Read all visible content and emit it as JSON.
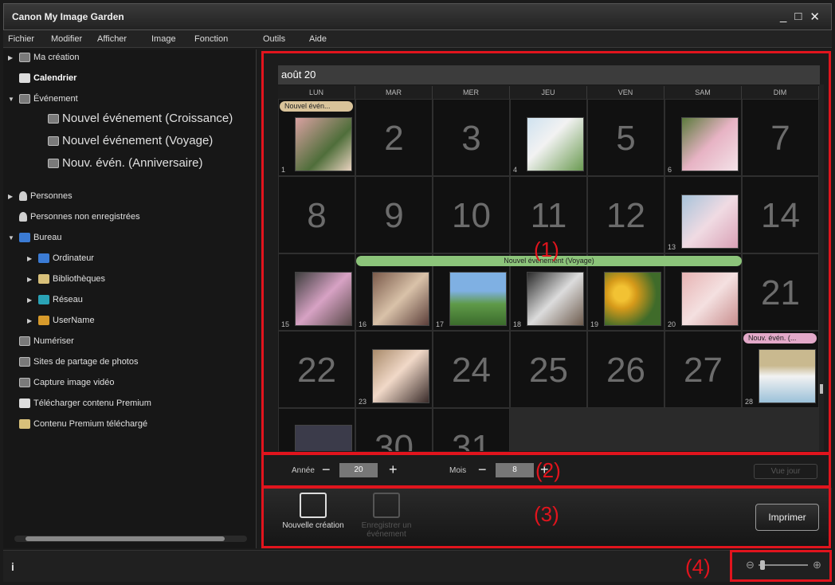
{
  "window": {
    "title": "Canon My Image Garden",
    "controls": [
      "_",
      "□",
      "✕"
    ]
  },
  "menu": [
    "Fichier",
    "Modifier",
    "Afficher",
    "Image",
    "Fonction",
    "Outils",
    "Aide"
  ],
  "sidebar": {
    "items": [
      {
        "label": "Ma création"
      },
      {
        "label": "Calendrier"
      },
      {
        "label": "Événement"
      },
      {
        "label": "Nouvel événement (Croissance)"
      },
      {
        "label": "Nouvel événement (Voyage)"
      },
      {
        "label": "Nouv. évén. (Anniversaire)"
      },
      {
        "label": "Personnes"
      },
      {
        "label": "Personnes non enregistrées"
      },
      {
        "label": "Bureau"
      },
      {
        "label": "Ordinateur"
      },
      {
        "label": "Bibliothèques"
      },
      {
        "label": "Réseau"
      },
      {
        "label": "UserName"
      },
      {
        "label": "Numériser"
      },
      {
        "label": "Sites de partage de photos"
      },
      {
        "label": "Capture image vidéo"
      },
      {
        "label": "Télécharger contenu Premium"
      },
      {
        "label": "Contenu Premium téléchargé"
      }
    ]
  },
  "calendar": {
    "month_title": "août 20",
    "weekdays": [
      "LUN",
      "MAR",
      "MER",
      "JEU",
      "VEN",
      "SAM",
      "DIM"
    ],
    "big_days": [
      "2",
      "3",
      "5",
      "7",
      "8",
      "9",
      "10",
      "11",
      "12",
      "14",
      "21",
      "22",
      "24",
      "25",
      "26",
      "27",
      "30",
      "31"
    ],
    "photo_days": [
      "1",
      "4",
      "6",
      "13",
      "15",
      "16",
      "17",
      "18",
      "19",
      "20",
      "23",
      "28"
    ],
    "events": {
      "growth": "Nouvel évén...",
      "travel": "Nouvel événement (Voyage)",
      "birthday": "Nouv. évén. (..."
    }
  },
  "navigation": {
    "year_label": "Année",
    "year_value": "20",
    "month_label": "Mois",
    "month_value": "8",
    "minus": "−",
    "plus": "+",
    "day_view": "Vue jour"
  },
  "actions": {
    "new_creation": "Nouvelle création",
    "register_event": "Enregistrer un événement",
    "print": "Imprimer"
  },
  "status": {
    "info": "i",
    "zoom_minus": "⊖",
    "zoom_plus": "⊕"
  },
  "callouts": [
    "(1)",
    "(2)",
    "(3)",
    "(4)"
  ],
  "colors": {
    "accent_red": "#e1141d",
    "event_growth": "#d9c39a",
    "event_travel": "#8cc47a",
    "event_birthday": "#e3a9c9"
  }
}
